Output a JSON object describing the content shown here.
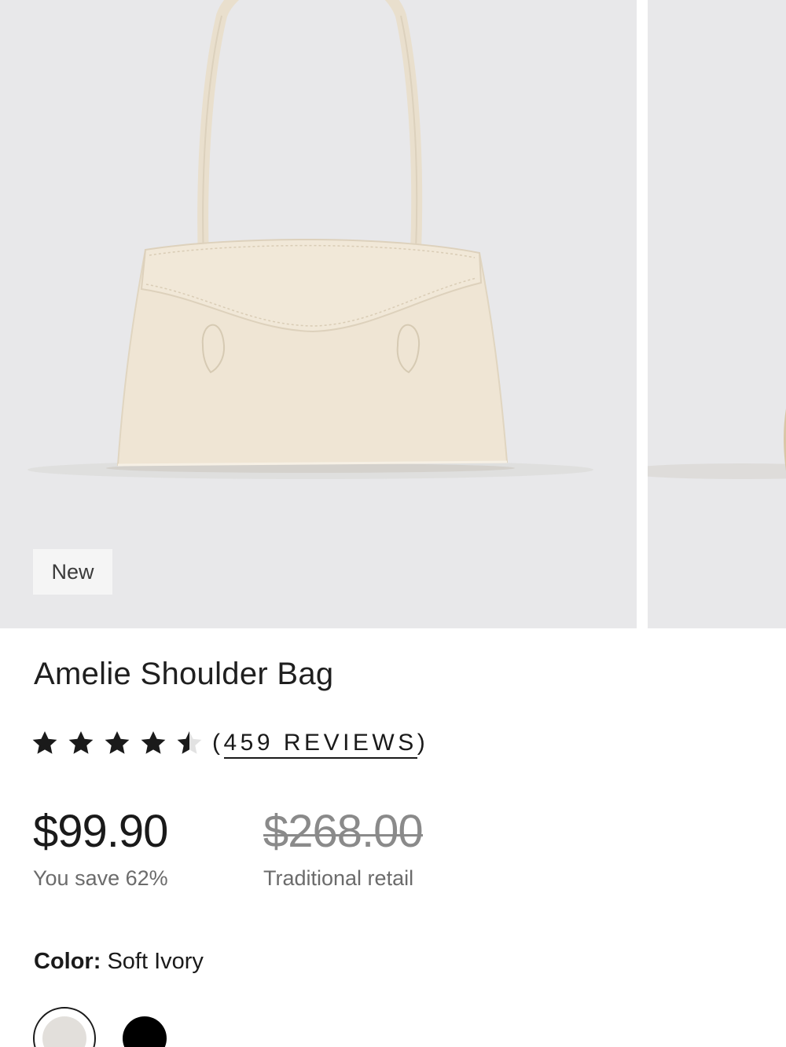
{
  "product": {
    "badge": "New",
    "title": "Amelie Shoulder Bag",
    "rating": {
      "value": 4.5,
      "max": 5,
      "reviews_text": "459 REVIEWS",
      "open_paren": "(",
      "close_paren": ")"
    },
    "price": {
      "sale": "$99.90",
      "sale_note": "You save 62%",
      "retail": "$268.00",
      "retail_note": "Traditional retail"
    },
    "color": {
      "label": "Color:",
      "value": "Soft Ivory"
    },
    "swatches": [
      {
        "name": "Soft Ivory",
        "hex": "#e2dfdb",
        "selected": true
      },
      {
        "name": "Black",
        "hex": "#000000",
        "selected": false
      }
    ]
  },
  "colors": {
    "gallery_bg": "#e8e8ea",
    "bag": "#efe5d4",
    "star": "#1a1a1a",
    "price_old": "#8a8a8a"
  }
}
